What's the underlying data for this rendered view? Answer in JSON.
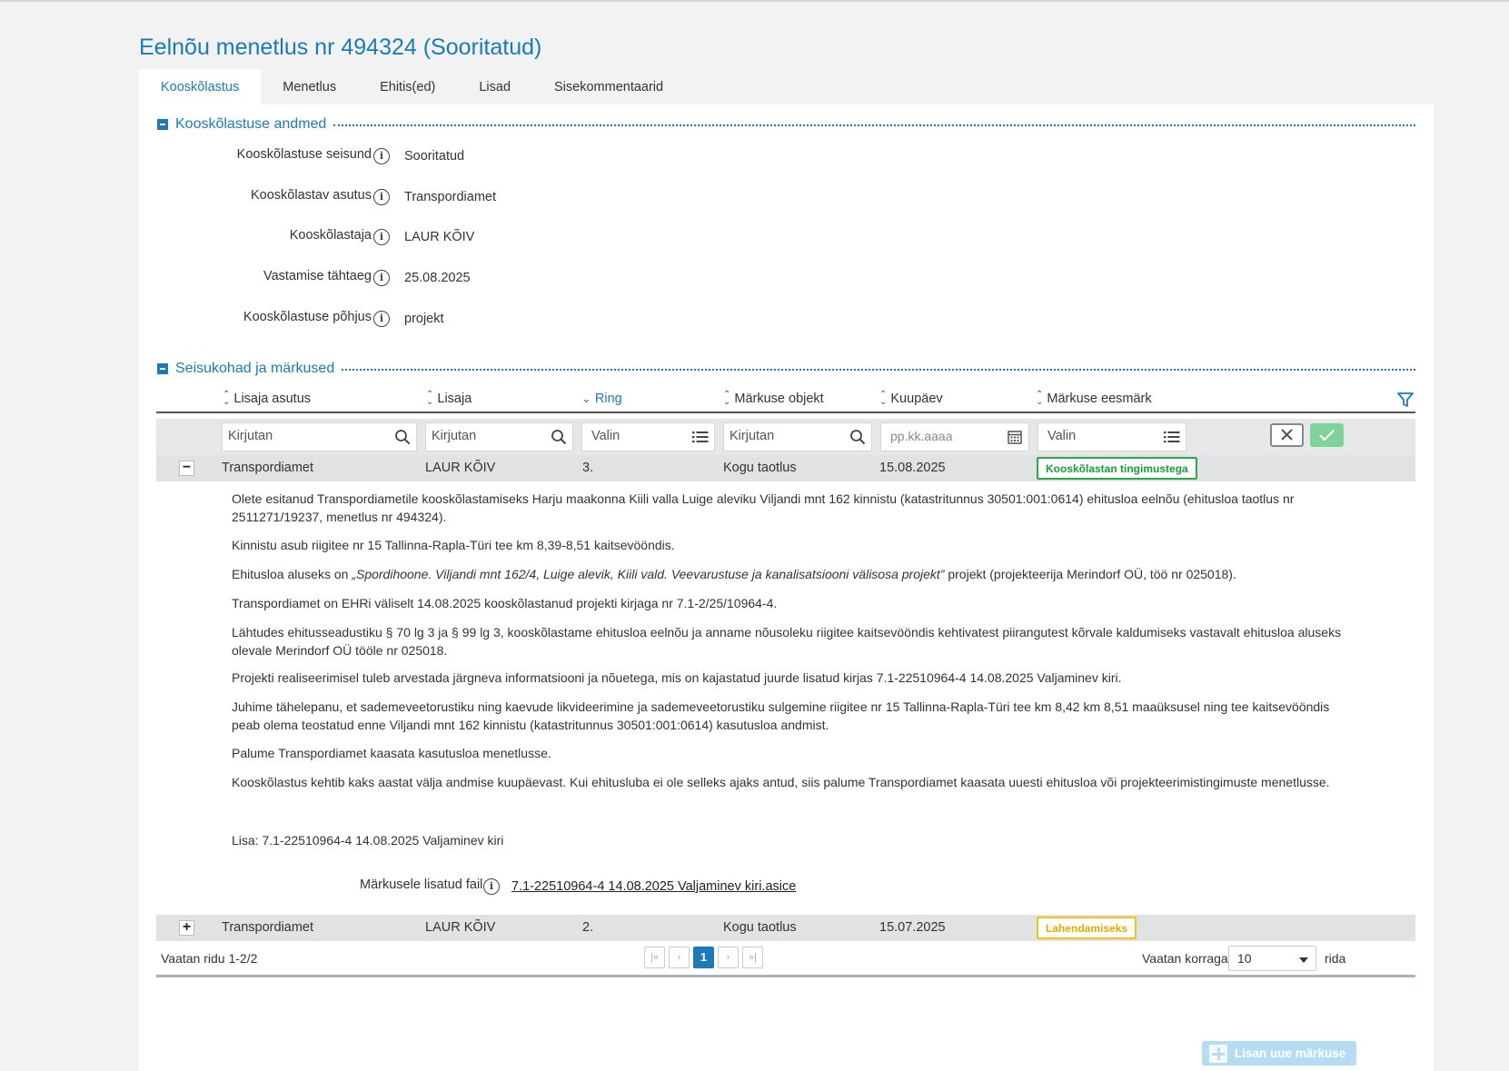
{
  "page": {
    "title": "Eelnõu menetlus nr 494324 (Sooritatud)"
  },
  "tabs": [
    {
      "label": "Kooskõlastus",
      "active": true
    },
    {
      "label": "Menetlus"
    },
    {
      "label": "Ehitis(ed)"
    },
    {
      "label": "Lisad"
    },
    {
      "label": "Sisekommentaarid"
    }
  ],
  "section1": {
    "title": "Kooskõlastuse andmed",
    "fields": [
      {
        "label": "Kooskõlastuse seisund",
        "value": "Sooritatud"
      },
      {
        "label": "Kooskõlastav asutus",
        "value": "Transpordiamet"
      },
      {
        "label": "Kooskõlastaja",
        "value": "LAUR KÕIV"
      },
      {
        "label": "Vastamise tähtaeg",
        "value": "25.08.2025"
      },
      {
        "label": "Kooskõlastuse põhjus",
        "value": "projekt"
      }
    ]
  },
  "section2": {
    "title": "Seisukohad ja märkused"
  },
  "grid": {
    "columns": [
      "Lisaja asutus",
      "Lisaja",
      "Ring",
      "Märkuse objekt",
      "Kuupäev",
      "Märkuse eesmärk"
    ],
    "filters": {
      "lisaja_asutus": "Kirjutan",
      "lisaja": "Kirjutan",
      "ring": "Valin",
      "objekt": "Kirjutan",
      "kuupaev_placeholder": "pp.kk.aaaa",
      "eesmark": "Valin"
    },
    "rows": [
      {
        "toggle": "−",
        "asutus": "Transpordiamet",
        "lisaja": "LAUR KÕIV",
        "ring": "3.",
        "objekt": "Kogu taotlus",
        "kuupaev": "15.08.2025",
        "eesmark": "Kooskõlastan tingimustega",
        "badge_color": "#2aa84a"
      },
      {
        "toggle": "+",
        "asutus": "Transpordiamet",
        "lisaja": "LAUR KÕIV",
        "ring": "2.",
        "objekt": "Kogu taotlus",
        "kuupaev": "15.07.2025",
        "eesmark": "Lahendamiseks",
        "badge_color": "#f3c21a"
      }
    ],
    "detail": {
      "p1": "Olete esitanud Transpordiametile kooskõlastamiseks Harju maakonna Kiili valla Luige aleviku Viljandi mnt 162 kinnistu (katastritunnus 30501:001:0614) ehitusloa eelnõu (ehitusloa taotlus nr 2511271/19237, menetlus nr 494324).",
      "p2": "Kinnistu asub riigitee nr 15 Tallinna-Rapla-Türi tee km 8,39-8,51 kaitsevööndis.",
      "p3_a": "Ehitusloa aluseks on ",
      "p3_em": "„Spordihoone. Viljandi mnt 162/4, Luige alevik, Kiili vald. Veevarustuse ja kanalisatsiooni välisosa projekt”",
      "p3_b": " projekt (projekteerija Merindorf OÜ, töö nr 025018).",
      "p4": "Transpordiamet on EHRi väliselt 14.08.2025 kooskõlastanud projekti kirjaga nr  7.1-2/25/10964-4.",
      "p5": "Lähtudes ehitusseadustiku § 70 lg 3 ja § 99 lg 3, kooskõlastame ehitusloa eelnõu ja anname nõusoleku riigitee kaitsevööndis kehtivatest piirangutest kõrvale kaldumiseks vastavalt ehitusloa aluseks olevale Merindorf OÜ tööle nr 025018.",
      "p6": "Projekti realiseerimisel tuleb arvestada järgneva informatsiooni ja nõuetega, mis on kajastatud juurde lisatud kirjas 7.1-22510964-4 14.08.2025 Valjaminev kiri.",
      "p7": "Juhime tähelepanu, et sademeveetorustiku ning kaevude likvideerimine ja sademeveetorustiku sulgemine riigitee nr 15 Tallinna-Rapla-Türi tee km 8,42 km 8,51 maaüksusel ning tee kaitsevööndis peab olema teostatud enne Viljandi mnt 162 kinnistu (katastritunnus 30501:001:0614) kasutusloa andmist.",
      "p8": "Palume Transpordiamet kaasata kasutusloa menetlusse.",
      "p9": "Kooskõlastus kehtib kaks aastat välja andmise kuupäevast. Kui ehitusluba ei ole selleks ajaks antud, siis palume Transpordiamet kaasata uuesti ehitusloa või projekteerimistingimuste menetlusse.",
      "p10": "Lisa: 7.1-22510964-4 14.08.2025 Valjaminev kiri",
      "attach_label": "Märkusele lisatud fail",
      "attach_file": "7.1-22510964-4 14.08.2025 Valjaminev kiri.asice"
    },
    "footer": {
      "rows_text": "Vaatan ridu 1-2/2",
      "pager": [
        "|«",
        "‹",
        "1",
        "›",
        "»|"
      ],
      "per_page_label": "Vaatan korraga",
      "per_page_value": "10",
      "per_page_suffix": "rida"
    }
  },
  "add_button": "Lisan uue märkuse",
  "colors": {
    "accent": "#1a7bb8",
    "ok_button": "#7fd39a",
    "add_button": "#b6dcf3"
  }
}
